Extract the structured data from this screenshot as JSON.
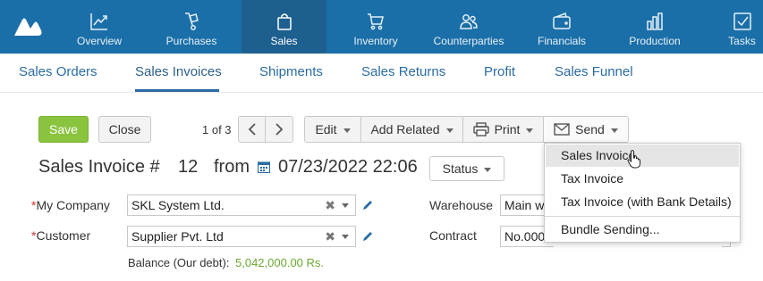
{
  "colors": {
    "topbar": "#1b6fa8",
    "active_tab": "#1d5f8f",
    "link": "#2a6ca3",
    "save_green": "#8ac43f",
    "balance_green": "#6aa830",
    "required": "#d9322c"
  },
  "topnav": {
    "items": [
      {
        "label": "Overview",
        "icon": "chart-line-icon"
      },
      {
        "label": "Purchases",
        "icon": "hand-truck-icon"
      },
      {
        "label": "Sales",
        "icon": "shopping-bag-icon",
        "active": true
      },
      {
        "label": "Inventory",
        "icon": "cart-icon"
      },
      {
        "label": "Counterparties",
        "icon": "people-icon"
      },
      {
        "label": "Financials",
        "icon": "wallet-icon"
      },
      {
        "label": "Production",
        "icon": "bar-chart-icon"
      },
      {
        "label": "Tasks",
        "icon": "checkbox-icon"
      }
    ]
  },
  "subnav": {
    "tabs": [
      {
        "label": "Sales Orders"
      },
      {
        "label": "Sales Invoices",
        "active": true
      },
      {
        "label": "Shipments"
      },
      {
        "label": "Sales Returns"
      },
      {
        "label": "Profit"
      },
      {
        "label": "Sales Funnel"
      }
    ]
  },
  "toolbar": {
    "save_label": "Save",
    "close_label": "Close",
    "pager_text": "1 of 3",
    "edit_label": "Edit",
    "add_related_label": "Add Related",
    "print_label": "Print",
    "send_label": "Send"
  },
  "header": {
    "title": "Sales Invoice #",
    "number": "12",
    "from_label": "from",
    "date": "07/23/2022 22:06",
    "status_label": "Status"
  },
  "form": {
    "company_label": "My Company",
    "company_value": "SKL System Ltd.",
    "customer_label": "Customer",
    "customer_value": "Supplier Pvt. Ltd",
    "warehouse_label": "Warehouse",
    "warehouse_value": "Main wa",
    "contract_label": "Contract",
    "contract_value": "No.0000",
    "balance_label": "Balance (Our debt):",
    "balance_value": "5,042,000.00 Rs."
  },
  "send_menu": {
    "items": [
      {
        "label": "Sales Invoice",
        "hovered": true
      },
      {
        "label": "Tax Invoice"
      },
      {
        "label": "Tax Invoice (with Bank Details)"
      },
      {
        "label": "Bundle Sending..."
      }
    ]
  }
}
